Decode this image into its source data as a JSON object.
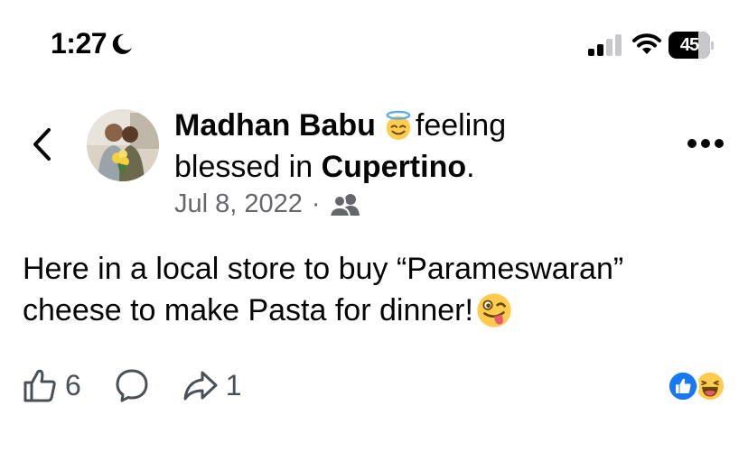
{
  "status": {
    "time": "1:27",
    "battery": "45"
  },
  "post": {
    "author": "Madhan Babu",
    "feeling_text": "feeling",
    "blessed_text": "blessed in",
    "location": "Cupertino",
    "period": ".",
    "date": "Jul 8, 2022",
    "separator": "·",
    "body_line1": "Here in a local store to buy “Parameswaran”",
    "body_line2": "cheese to make Pasta for dinner!",
    "likes": "6",
    "shares": "1"
  },
  "icons": {
    "back": "chevron-left-icon",
    "more": "more-horizontal-icon",
    "like": "thumbs-up-icon",
    "comment": "comment-icon",
    "share": "share-icon",
    "audience": "friends-icon",
    "feeling_emoji": "smiling-face-with-halo",
    "body_emoji": "winking-face-with-tongue"
  },
  "colors": {
    "like_blue": "#1877f2",
    "secondary_text": "#65676b",
    "emoji_yellow": "#ffcc4d"
  }
}
